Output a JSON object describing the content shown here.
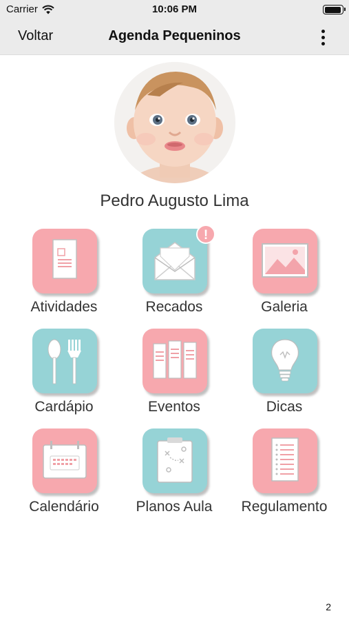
{
  "status_bar": {
    "carrier": "Carrier",
    "time": "10:06 PM",
    "icons": [
      "wifi-icon",
      "battery-icon"
    ]
  },
  "nav": {
    "back_label": "Voltar",
    "title": "Agenda Pequeninos",
    "more_icon": "vertical-ellipsis-icon"
  },
  "profile": {
    "name": "Pedro Augusto Lima",
    "avatar": "baby-photo"
  },
  "menu": [
    {
      "label": "Atividades",
      "icon": "document-icon",
      "color": "#f7a8ae"
    },
    {
      "label": "Recados",
      "icon": "envelope-icon",
      "color": "#96d3d6",
      "badge": "!"
    },
    {
      "label": "Galeria",
      "icon": "picture-icon",
      "color": "#f7a8ae"
    },
    {
      "label": "Cardápio",
      "icon": "spoon-fork-icon",
      "color": "#96d3d6"
    },
    {
      "label": "Eventos",
      "icon": "newspaper-icon",
      "color": "#f7a8ae"
    },
    {
      "label": "Dicas",
      "icon": "lightbulb-icon",
      "color": "#96d3d6"
    },
    {
      "label": "Calendário",
      "icon": "calendar-icon",
      "color": "#f7a8ae"
    },
    {
      "label": "Planos Aula",
      "icon": "clipboard-plan-icon",
      "color": "#96d3d6"
    },
    {
      "label": "Regulamento",
      "icon": "list-document-icon",
      "color": "#f7a8ae"
    }
  ],
  "page_number": "2",
  "colors": {
    "pink": "#f7a8ae",
    "teal": "#96d3d6",
    "bar_bg": "#ebebeb"
  }
}
